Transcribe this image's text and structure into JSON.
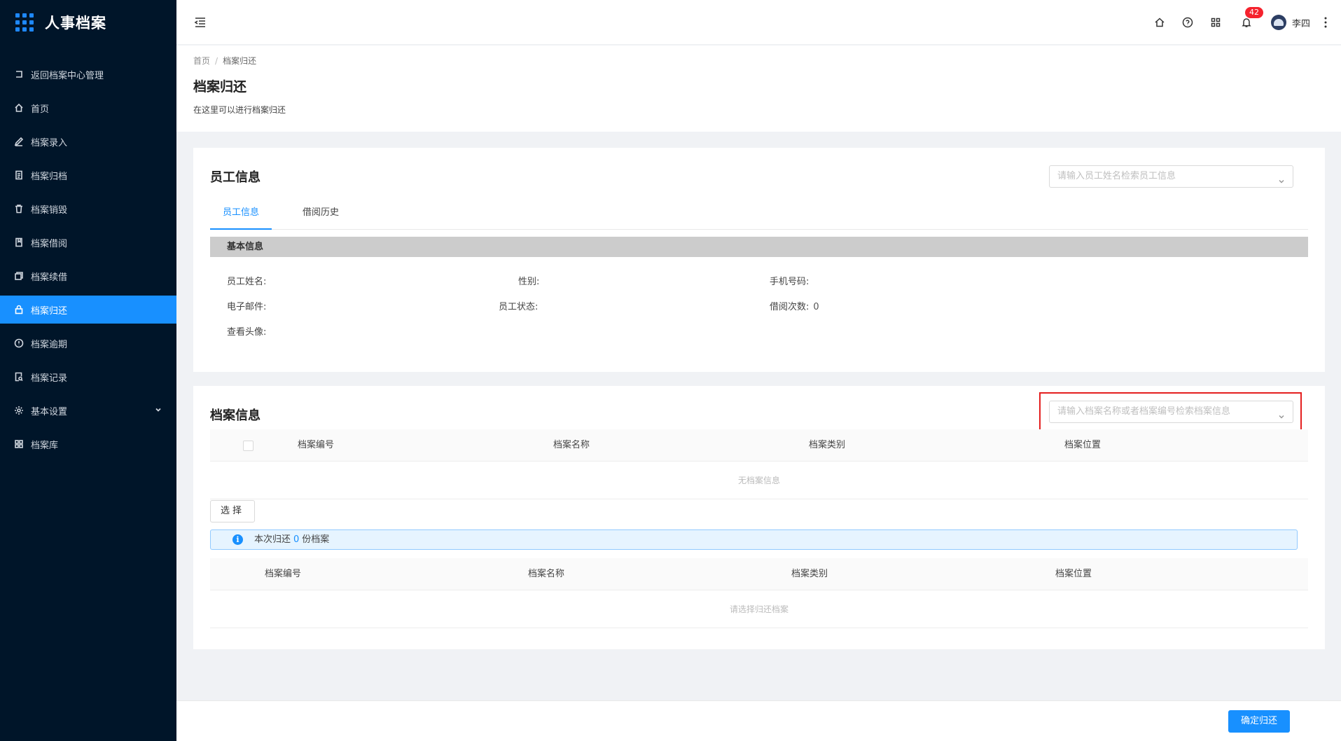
{
  "app": {
    "title": "人事档案"
  },
  "sidebar": {
    "items": [
      {
        "label": "返回档案中心管理",
        "icon": "return-icon"
      },
      {
        "label": "首页",
        "icon": "home-icon"
      },
      {
        "label": "档案录入",
        "icon": "edit-icon"
      },
      {
        "label": "档案归档",
        "icon": "file-icon"
      },
      {
        "label": "档案销毁",
        "icon": "delete-icon"
      },
      {
        "label": "档案借阅",
        "icon": "book-icon"
      },
      {
        "label": "档案续借",
        "icon": "copy-icon"
      },
      {
        "label": "档案归还",
        "icon": "lock-icon",
        "active": true
      },
      {
        "label": "档案逾期",
        "icon": "alert-circle-icon"
      },
      {
        "label": "档案记录",
        "icon": "file-search-icon"
      },
      {
        "label": "基本设置",
        "icon": "gear-icon",
        "has_submenu": true
      },
      {
        "label": "档案库",
        "icon": "grid-icon"
      }
    ]
  },
  "header": {
    "notification_count": "42",
    "user_name": "李四"
  },
  "breadcrumb": {
    "home": "首页",
    "separator": "/",
    "current": "档案归还"
  },
  "page": {
    "title": "档案归还",
    "description": "在这里可以进行档案归还"
  },
  "employee": {
    "title": "员工信息",
    "search_placeholder": "请输入员工姓名检索员工信息",
    "tabs": [
      "员工信息",
      "借阅历史"
    ],
    "basic_info_title": "基本信息",
    "fields": {
      "name_label": "员工姓名:",
      "gender_label": "性别:",
      "phone_label": "手机号码:",
      "email_label": "电子邮件:",
      "status_label": "员工状态:",
      "borrow_count_label": "借阅次数:",
      "borrow_count_value": "0",
      "avatar_label": "查看头像:"
    }
  },
  "archive": {
    "title": "档案信息",
    "search_placeholder": "请输入档案名称或者档案编号检索档案信息",
    "columns": [
      "档案编号",
      "档案名称",
      "档案类别",
      "档案位置"
    ],
    "empty_text": "无档案信息",
    "select_button": "选择",
    "alert_prefix": "本次归还",
    "alert_count": "0",
    "alert_suffix": "份档案",
    "selected_empty_text": "请选择归还档案"
  },
  "footer": {
    "confirm_button": "确定归还"
  },
  "colors": {
    "sidebar_bg": "#001529",
    "primary": "#1890ff",
    "highlight": "#e41f1f"
  }
}
